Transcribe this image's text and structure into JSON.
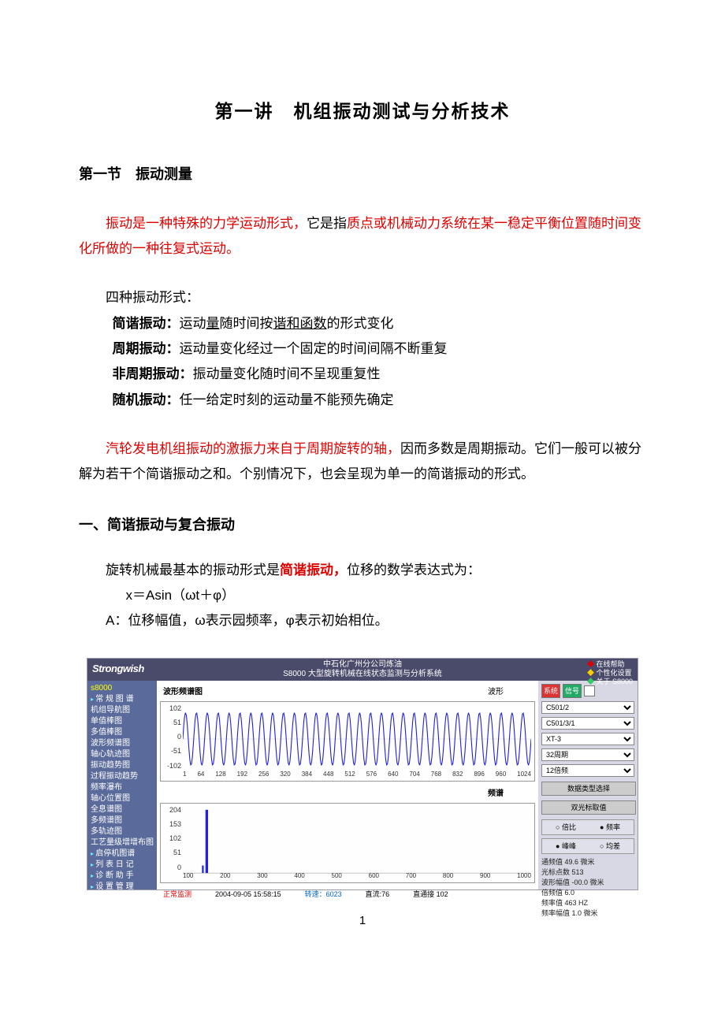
{
  "title": "第一讲　机组振动测试与分析技术",
  "section1": "第一节　振动测量",
  "intro_a": "振动是一种特殊的力学运动形式，",
  "intro_b": "它是指",
  "intro_c": "质点或机械动力系统在某一稳定平衡位置随时间变化所做的一种往复式运动。",
  "four_heading": "四种振动形式：",
  "defs": {
    "harm_l": "简谐振动：",
    "harm_pre": "运动",
    "harm_ul": "量",
    "harm_mid": "随时间按",
    "harm_ul2": "谐和函数",
    "harm_post": "的形式变化",
    "per_l": "周期振动：",
    "per_t": "运动量变化经过一个固定的时间间隔不断重复",
    "nper_l": "非周期振动：",
    "nper_t": "振动量变化随时间不呈现重复性",
    "rand_l": "随机振动：",
    "rand_t": "任一给定时刻的运动量不能预先确定"
  },
  "para2_a": "汽轮发电机组振动的激振力来自于周期旋转的轴，",
  "para2_b": "因而多数是周期振动。它们一般可以被分解为若干个简谐振动之和。个别情况下，也会呈现为单一的简谐振动的形式。",
  "sub1": "一、简谐振动与复合振动",
  "p3_a": "旋转机械最基本的振动形式是",
  "p3_b": "简谐振动，",
  "p3_c": "位移的数学表达式为：",
  "math": "x＝Asin（ωt＋φ）",
  "p4": "A：位移幅值，ω表示园频率，φ表示初始相位。",
  "page_num": "1",
  "app": {
    "brand": "Strongwish",
    "hdr_line1": "中石化广州分公司炼油",
    "hdr_line2": "S8000 大型旋转机械在线状态监测与分析系统",
    "hdr_links": [
      "在线帮助",
      "个性化设置",
      "关于 S8000"
    ],
    "unit_code": "s8000",
    "menu": [
      {
        "t": "常 规 图 谱",
        "f": true
      },
      {
        "t": "机组导航图"
      },
      {
        "t": "单值棒图"
      },
      {
        "t": "多值棒图"
      },
      {
        "t": "波形频谱图"
      },
      {
        "t": "轴心轨迹图"
      },
      {
        "t": "振动趋势图"
      },
      {
        "t": "过程振动趋势"
      },
      {
        "t": "频率瀑布"
      },
      {
        "t": "轴心位置图"
      },
      {
        "t": "全息谱图"
      },
      {
        "t": "多频谱图"
      },
      {
        "t": "多轨迹图"
      },
      {
        "t": "工艺量级增增布图"
      },
      {
        "t": "启停机图谱",
        "f": true
      },
      {
        "t": "列 表 日 记",
        "f": true
      },
      {
        "t": "诊 断 助 手",
        "f": true
      },
      {
        "t": "设 置 管 理",
        "f": true
      }
    ],
    "content_title": "波形频谱图",
    "wave_label": "波形",
    "spec_label": "频谱",
    "wave_y": [
      "102",
      "51",
      "0",
      "-51",
      "-102"
    ],
    "wave_x": [
      "1",
      "64",
      "128",
      "192",
      "256",
      "320",
      "384",
      "448",
      "512",
      "576",
      "640",
      "704",
      "768",
      "832",
      "896",
      "960",
      "1024"
    ],
    "spec_y": [
      "204",
      "153",
      "102",
      "51",
      "0"
    ],
    "spec_x": [
      "100",
      "200",
      "300",
      "400",
      "500",
      "600",
      "700",
      "800",
      "900",
      "1000"
    ],
    "status": {
      "s1": "正常监测",
      "s2": "2004-09-05 15:58:15",
      "s3": "转速：6023",
      "s4": "直流:76",
      "s5": "直通接 102"
    },
    "rp": {
      "btn_sys": "系统",
      "btn_sig": "信号",
      "selects": [
        "C501/2",
        "C501/3/1",
        "XT-3",
        "32周期",
        "12倍频"
      ],
      "btn_type": "数据类型选择",
      "btn_cursor": "双光标取值",
      "g1_a": "倍比",
      "g1_b": "频率",
      "g2_a": "峰峰",
      "g2_b": "均差",
      "info": [
        "通频值 49.6 微米",
        "光标点数 513",
        "波形幅值 -00.0 微米",
        "倍频值 6.0",
        "频率值 463 HZ",
        "频率幅值 1.0 微米"
      ]
    }
  },
  "chart_data": [
    {
      "type": "line",
      "title": "波形",
      "x": [
        1,
        64,
        128,
        192,
        256,
        320,
        384,
        448,
        512,
        576,
        640,
        704,
        768,
        832,
        896,
        960,
        1024
      ],
      "ylim": [
        -102,
        102
      ],
      "note": "periodic sinusoidal waveform, ~32 cycles, peak ~80"
    },
    {
      "type": "bar",
      "title": "频谱",
      "x": [
        100,
        200,
        300,
        400,
        500,
        600,
        700,
        800,
        900,
        1000
      ],
      "ylim": [
        0,
        204
      ],
      "peak_at": 100,
      "peak_value": 200,
      "note": "single dominant spectral peak near x≈100"
    }
  ]
}
